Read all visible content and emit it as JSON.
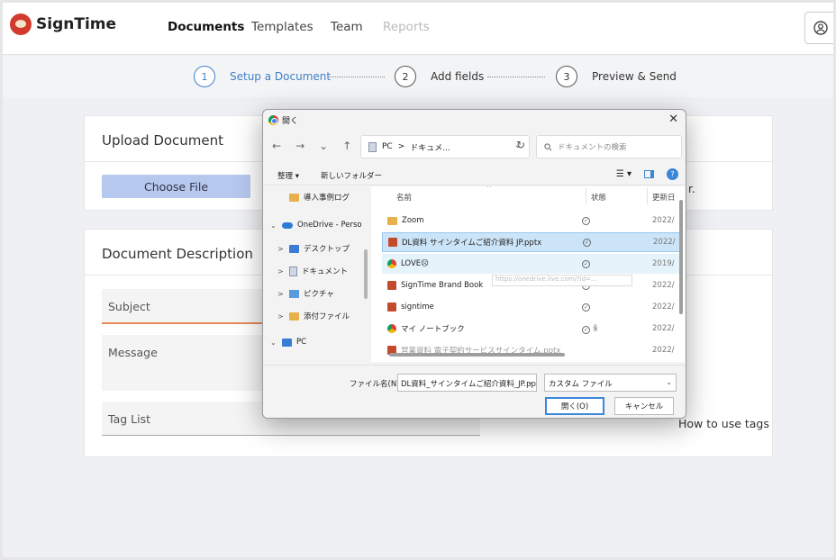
{
  "app": {
    "brand": "SignTime",
    "nav": [
      {
        "label": "Documents",
        "state": "active"
      },
      {
        "label": "Templates",
        "state": "normal"
      },
      {
        "label": "Team",
        "state": "normal"
      },
      {
        "label": "Reports",
        "state": "disabled"
      }
    ],
    "user_icon": "user-circle-icon"
  },
  "steps": [
    {
      "num": "1",
      "label": "Setup a Document"
    },
    {
      "num": "2",
      "label": "Add fields"
    },
    {
      "num": "3",
      "label": "Preview & Send"
    }
  ],
  "upload": {
    "title": "Upload Document",
    "choose_label": "Choose File",
    "trailing_text": "r."
  },
  "description": {
    "title": "Document Description",
    "subject_placeholder": "Subject",
    "message_placeholder": "Message",
    "tags_placeholder": "Tag List",
    "how_to_tags": "How to use tags"
  },
  "dialog": {
    "title": "開く",
    "close": "✕",
    "nav": {
      "back": "←",
      "forward": "→",
      "down": "⌄",
      "up": "↑",
      "refresh": "↻"
    },
    "address": {
      "root": "PC",
      "sep": ">",
      "current": "ドキュメ..."
    },
    "search_placeholder": "ドキュメントの検索",
    "toolbar": {
      "organize": "整理 ▾",
      "new_folder": "新しいフォルダー",
      "view": "☰ ▾",
      "help": "?"
    },
    "tree": [
      {
        "label": "導入事例ログ",
        "icon": "folder",
        "arrow": ""
      },
      {
        "label": "OneDrive - Perso",
        "icon": "cloud",
        "arrow": "⌄"
      },
      {
        "label": "デスクトップ",
        "icon": "desktop",
        "arrow": ">"
      },
      {
        "label": "ドキュメント",
        "icon": "document",
        "arrow": ">"
      },
      {
        "label": "ピクチャ",
        "icon": "picture",
        "arrow": ">"
      },
      {
        "label": "添付ファイル",
        "icon": "folder",
        "arrow": ">"
      },
      {
        "label": "PC",
        "icon": "monitor",
        "arrow": "⌄"
      }
    ],
    "columns": {
      "name": "名前",
      "status": "状態",
      "date": "更新日"
    },
    "files": [
      {
        "name": "Zoom",
        "icon": "folder",
        "date": "2022/",
        "state": "normal"
      },
      {
        "name": "DL資料 サインタイムご紹介資料 JP.pptx",
        "icon": "ppt",
        "date": "2022/",
        "state": "selected"
      },
      {
        "name": "LOVE☹",
        "icon": "chrome",
        "date": "2019/",
        "state": "hover"
      },
      {
        "name": "SignTime Brand Book",
        "icon": "ppt",
        "date": "2022/",
        "state": "normal"
      },
      {
        "name": "signtime",
        "icon": "ppt",
        "date": "2022/",
        "state": "normal"
      },
      {
        "name": "マイ ノートブック",
        "icon": "chrome",
        "date": "2022/",
        "state": "normal"
      },
      {
        "name": "営業資料 電子契約サービスサインタイム.pptx",
        "icon": "ppt",
        "date": "2022/",
        "state": "normal"
      }
    ],
    "tooltip": "https://onedrive.live.com/?id=...",
    "filename_label": "ファイル名(N):",
    "filename_value": "DL資料_サインタイムご紹介資料_JP.pptx",
    "filetype": "カスタム ファイル",
    "open_label": "開く(O)",
    "cancel_label": "キャンセル"
  }
}
